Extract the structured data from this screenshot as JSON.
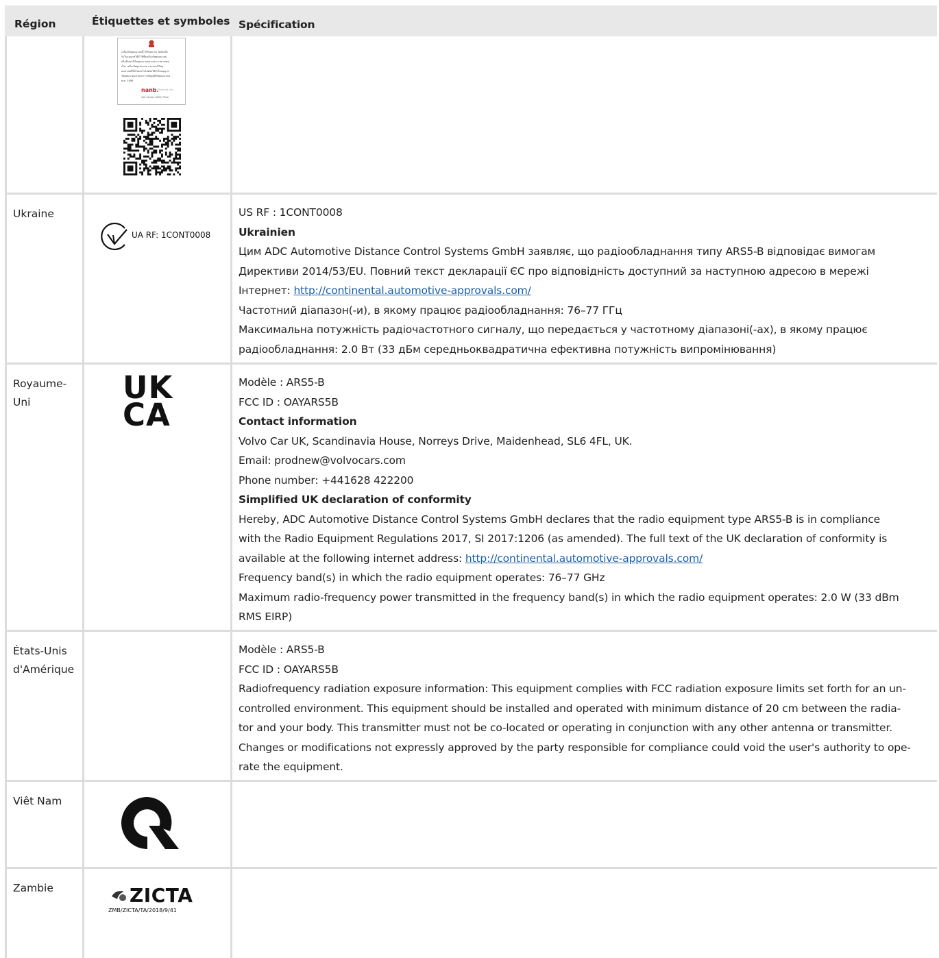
{
  "headers": {
    "region": "Région",
    "labels": "Étiquettes et symboles",
    "spec": "Spécification"
  },
  "thai": {
    "text_lines": [
      "เครื่องวิทยุคมนาคมนี้ ได้รับยกเว้น ไม่ต้องได้",
      "รับใบอนุญาตให้มี ใช้ซึ่งเครื่องวิทยุคมนาคม",
      "หรือตั้งสถานีวิทยุคมนาคมตามประกาศ กสทช.",
      "เรื่อง เครื่องวิทยุคมนาคม และสถานีวิทยุ",
      "คมนาคมที่ได้รับยกเว้นไม่ต้องได้รับใบอนุญาต",
      "วิทยุคมนาคมตามพระราชบัญญัติวิทยุคมนาคม",
      "พ.ศ. 2498"
    ],
    "brand": "nanb.",
    "brand_sub": "Thailand Ltd.",
    "call_center": "Call Center: 0000 (Thai)"
  },
  "rows": {
    "ukraine": {
      "region": "Ukraine",
      "mark_text": "UA RF: 1CONT0008",
      "us_rf": "US RF : 1CONT0008",
      "heading": "Ukrainien",
      "l1": "Цим ADC Automotive Distance Control Systems GmbH заявляє, що радіообладнання типу ARS5-B відповідає вимогам",
      "l2": "Директиви 2014/53/EU. Повний текст декларації ЄС про відповідність доступний за наступною адресою в мережі",
      "l3_prefix": "Інтернет: ",
      "link": "http://continental.automotive-approvals.com/",
      "l4": "Частотний діапазон(-и), в якому працює радіообладнання: 76–77 ГГц",
      "l5": "Максимальна потужність радіочастотного сигналу, що передається у частотному діапазоні(-ах), в якому працює",
      "l6": "радіообладнання: 2.0 Вт (33 дБм середньоквадратична ефективна потужність випромінювання)"
    },
    "uk": {
      "region": "Royaume-Uni",
      "mark_top": "UK",
      "mark_bottom": "CA",
      "model": "Modèle : ARS5-B",
      "fcc": "FCC ID : OAYARS5B",
      "contact_heading": "Contact information",
      "address": "Volvo Car UK, Scandinavia House, Norreys Drive, Maidenhead, SL6 4FL, UK.",
      "email": "Email: prodnew@volvocars.com",
      "phone": "Phone number: +441628 422200",
      "decl_heading": "Simplified UK declaration of conformity",
      "d1": "Hereby, ADC Automotive Distance Control Systems GmbH declares that the radio equipment type ARS5-B is in compliance",
      "d2": "with the Radio Equipment Regulations 2017, SI 2017:1206 (as amended). The full text of the UK declaration of conformity is",
      "d3_prefix": "available at the following internet address: ",
      "link": "http://continental.automotive-approvals.com/",
      "freq": "Frequency band(s) in which the radio equipment operates: 76–77 GHz",
      "p1": "Maximum radio-frequency power transmitted in the frequency band(s) in which the radio equipment operates: 2.0 W (33 dBm",
      "p2": "RMS EIRP)"
    },
    "usa": {
      "region_1": "États-Unis",
      "region_2": "d'Amérique",
      "model": "Modèle : ARS5-B",
      "fcc": "FCC ID : OAYARS5B",
      "r1": "Radiofrequency radiation exposure information: This equipment complies with FCC radiation exposure limits set forth for an un-",
      "r2": "controlled environment. This equipment should be installed and operated with minimum distance of 20 cm between the radia-",
      "r3": "tor and your body. This transmitter must not be co-located or operating in conjunction with any other antenna or transmitter.",
      "r4": "Changes or modifications not expressly approved by the party responsible for compliance could void the user's authority to ope-",
      "r5": "rate the equipment."
    },
    "vietnam": {
      "region": "Viêt Nam"
    },
    "zambia": {
      "region": "Zambie",
      "mark": "ZICTA",
      "mark_sub": "ZMB/ZICTA/TA/2018/9/41"
    }
  }
}
